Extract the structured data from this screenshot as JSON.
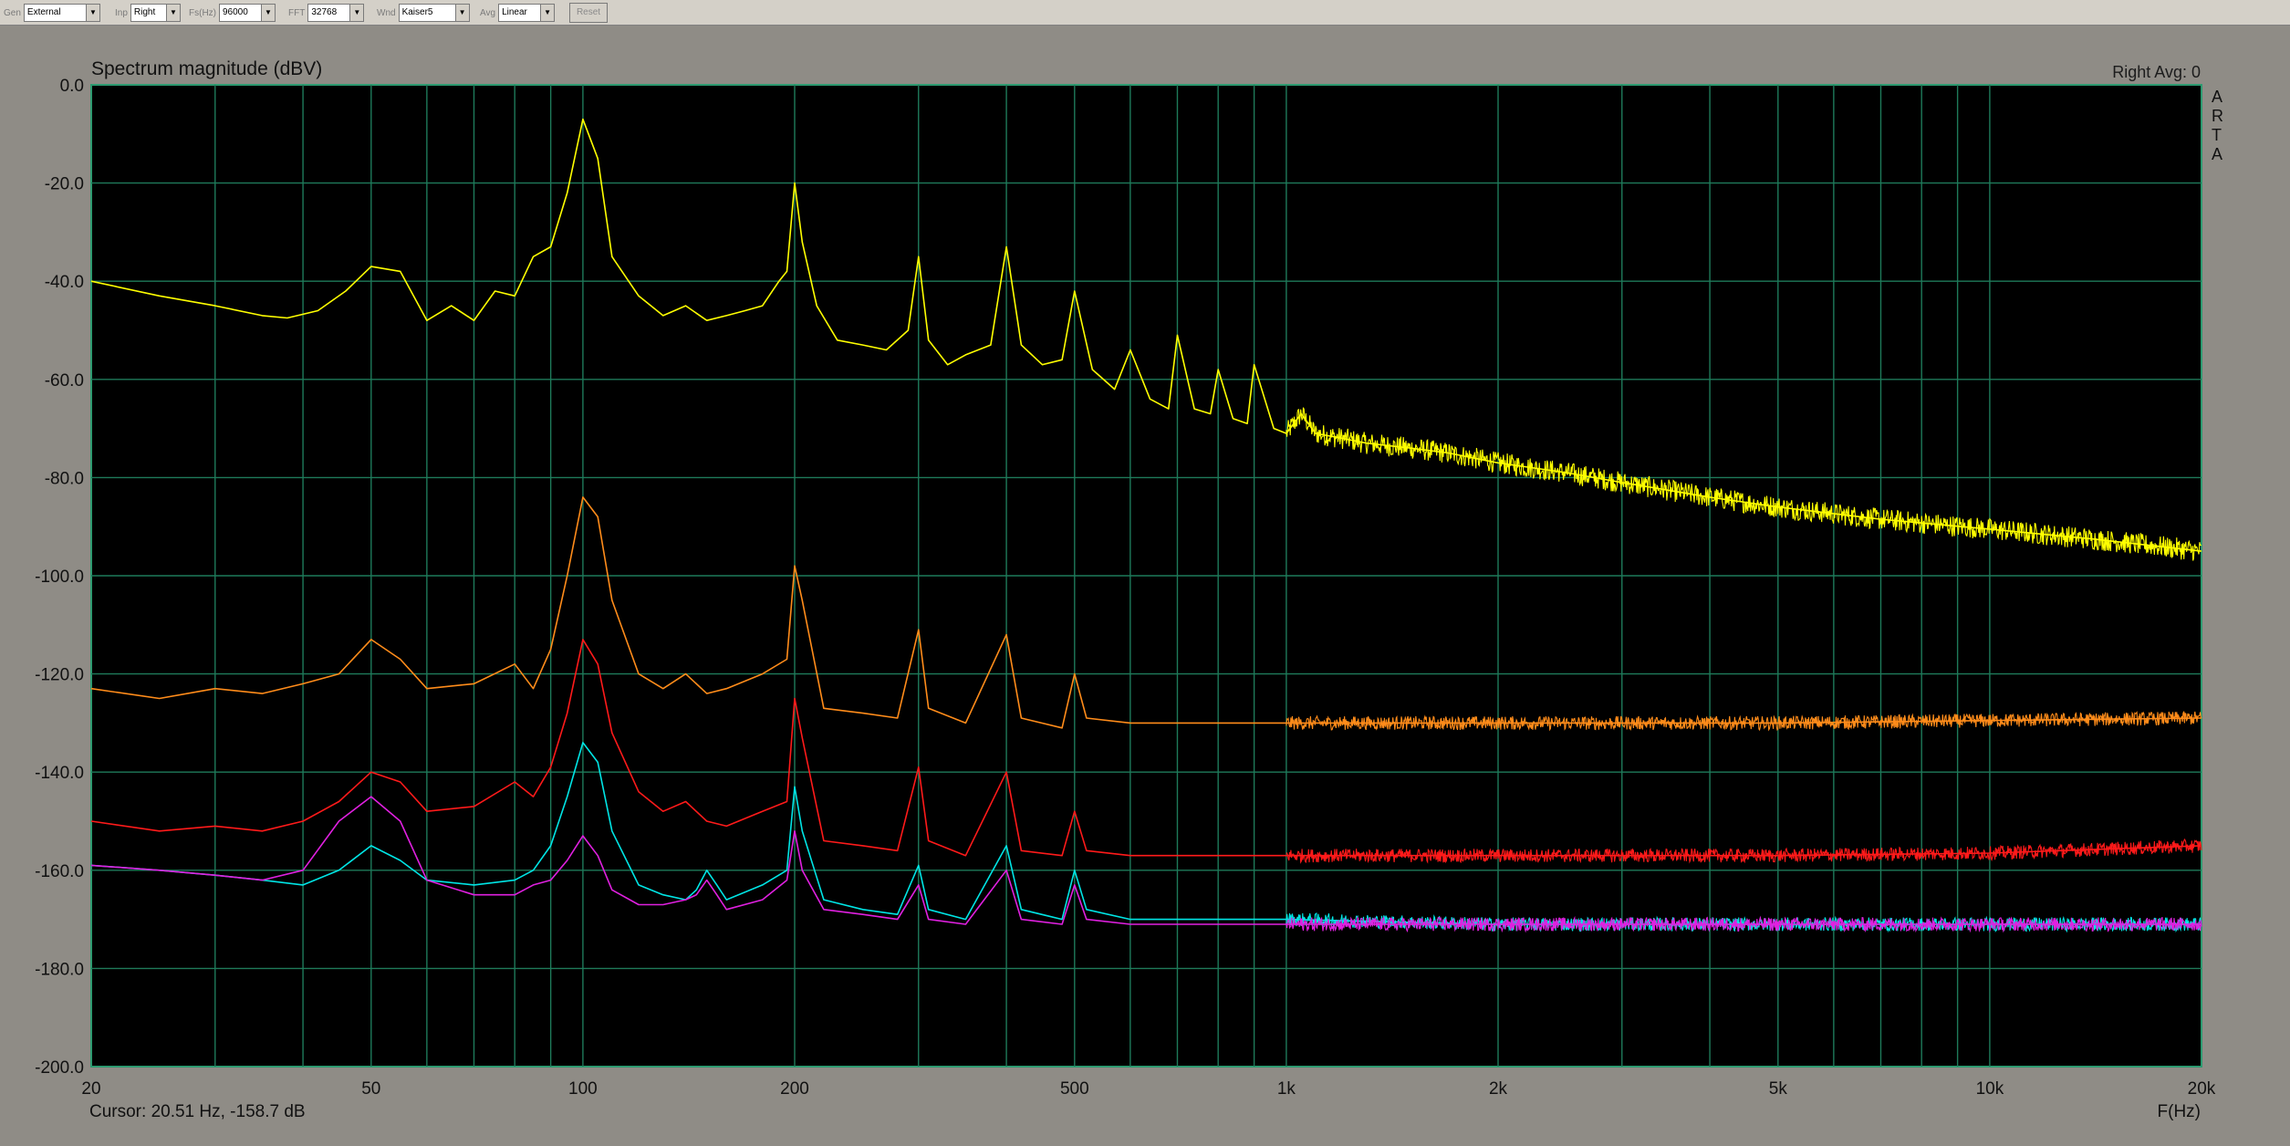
{
  "toolbar": {
    "gen_label": "Gen",
    "gen_value": "External",
    "inp_label": "Inp",
    "inp_value": "Right",
    "fs_label": "Fs(Hz)",
    "fs_value": "96000",
    "fft_label": "FFT",
    "fft_value": "32768",
    "wnd_label": "Wnd",
    "wnd_value": "Kaiser5",
    "avg_label": "Avg",
    "avg_value": "Linear",
    "reset_label": "Reset"
  },
  "overlay_status": "Right Avg: 0",
  "side_logo": [
    "A",
    "R",
    "T",
    "A"
  ],
  "cursor_text": "Cursor: 20.51 Hz, -158.7 dB",
  "colors": {
    "background": "#8f8c86",
    "plot_bg": "#000000",
    "grid": "#1e7a5a",
    "text": "#111111"
  },
  "chart_data": {
    "type": "line",
    "title": "Spectrum magnitude (dBV)",
    "xlabel": "F(Hz)",
    "ylabel": "",
    "x_scale": "log",
    "xlim": [
      20,
      20000
    ],
    "ylim": [
      -200,
      0
    ],
    "x_ticks": [
      {
        "v": 20,
        "label": "20"
      },
      {
        "v": 50,
        "label": "50"
      },
      {
        "v": 100,
        "label": "100"
      },
      {
        "v": 200,
        "label": "200"
      },
      {
        "v": 500,
        "label": "500"
      },
      {
        "v": 1000,
        "label": "1k"
      },
      {
        "v": 2000,
        "label": "2k"
      },
      {
        "v": 5000,
        "label": "5k"
      },
      {
        "v": 10000,
        "label": "10k"
      },
      {
        "v": 20000,
        "label": "20k"
      }
    ],
    "y_ticks": [
      {
        "v": 0,
        "label": "0.0"
      },
      {
        "v": -20,
        "label": "-20.0"
      },
      {
        "v": -40,
        "label": "-40.0"
      },
      {
        "v": -60,
        "label": "-60.0"
      },
      {
        "v": -80,
        "label": "-80.0"
      },
      {
        "v": -100,
        "label": "-100.0"
      },
      {
        "v": -120,
        "label": "-120.0"
      },
      {
        "v": -140,
        "label": "-140.0"
      },
      {
        "v": -160,
        "label": "-160.0"
      },
      {
        "v": -180,
        "label": "-180.0"
      },
      {
        "v": -200,
        "label": "-200.0"
      }
    ],
    "grid": true,
    "series": [
      {
        "color": "#ffff00",
        "x": [
          20,
          25,
          30,
          35,
          38,
          42,
          46,
          50,
          55,
          60,
          65,
          70,
          75,
          80,
          85,
          90,
          95,
          100,
          105,
          110,
          120,
          130,
          140,
          150,
          160,
          170,
          180,
          190,
          195,
          200,
          205,
          215,
          230,
          250,
          270,
          290,
          300,
          310,
          330,
          350,
          380,
          400,
          420,
          450,
          480,
          500,
          530,
          570,
          600,
          640,
          680,
          700,
          740,
          780,
          800,
          840,
          880,
          900,
          960,
          1000,
          1050,
          1100,
          1200,
          1300,
          1500,
          1700,
          2000,
          2500,
          3000,
          4000,
          5000,
          7000,
          10000,
          14000,
          20000
        ],
        "y": [
          -40,
          -43,
          -45,
          -47,
          -47.5,
          -46,
          -42,
          -37,
          -38,
          -48,
          -45,
          -48,
          -42,
          -43,
          -35,
          -33,
          -22,
          -7,
          -15,
          -35,
          -43,
          -47,
          -45,
          -48,
          -47,
          -46,
          -45,
          -40,
          -38,
          -20,
          -32,
          -45,
          -52,
          -53,
          -54,
          -50,
          -35,
          -52,
          -57,
          -55,
          -53,
          -33,
          -53,
          -57,
          -56,
          -42,
          -58,
          -62,
          -54,
          -64,
          -66,
          -51,
          -66,
          -67,
          -58,
          -68,
          -69,
          -57,
          -70,
          -71,
          -67,
          -71,
          -72,
          -73,
          -74,
          -75,
          -77,
          -79,
          -81,
          -84,
          -86,
          -88.5,
          -90.5,
          -92.5,
          -95
        ]
      },
      {
        "color": "#ff8c1a",
        "x": [
          20,
          25,
          30,
          35,
          40,
          45,
          50,
          55,
          60,
          70,
          80,
          85,
          90,
          95,
          100,
          105,
          110,
          120,
          130,
          140,
          150,
          160,
          180,
          195,
          200,
          205,
          220,
          250,
          280,
          300,
          310,
          350,
          400,
          420,
          480,
          500,
          520,
          600,
          700,
          1000,
          2000,
          5000,
          10000,
          20000
        ],
        "y": [
          -123,
          -125,
          -123,
          -124,
          -122,
          -120,
          -113,
          -117,
          -123,
          -122,
          -118,
          -123,
          -115,
          -100,
          -84,
          -88,
          -105,
          -120,
          -123,
          -120,
          -124,
          -123,
          -120,
          -117,
          -98,
          -105,
          -127,
          -128,
          -129,
          -111,
          -127,
          -130,
          -112,
          -129,
          -131,
          -120,
          -129,
          -130,
          -130,
          -130,
          -130,
          -130,
          -129.5,
          -129
        ]
      },
      {
        "color": "#ff1a1a",
        "x": [
          20,
          25,
          30,
          35,
          40,
          45,
          50,
          55,
          60,
          70,
          80,
          85,
          90,
          95,
          100,
          105,
          110,
          120,
          130,
          140,
          150,
          160,
          180,
          195,
          200,
          205,
          220,
          250,
          280,
          300,
          310,
          350,
          400,
          420,
          480,
          500,
          520,
          600,
          700,
          1000,
          2000,
          5000,
          10000,
          20000
        ],
        "y": [
          -150,
          -152,
          -151,
          -152,
          -150,
          -146,
          -140,
          -142,
          -148,
          -147,
          -142,
          -145,
          -139,
          -128,
          -113,
          -118,
          -132,
          -144,
          -148,
          -146,
          -150,
          -151,
          -148,
          -146,
          -125,
          -133,
          -154,
          -155,
          -156,
          -139,
          -154,
          -157,
          -140,
          -156,
          -157,
          -148,
          -156,
          -157,
          -157,
          -157,
          -157,
          -157,
          -156.5,
          -155
        ]
      },
      {
        "color": "#00e5e5",
        "x": [
          20,
          25,
          30,
          35,
          40,
          45,
          50,
          55,
          60,
          70,
          80,
          85,
          90,
          95,
          100,
          105,
          110,
          120,
          130,
          140,
          145,
          150,
          155,
          160,
          180,
          195,
          200,
          205,
          220,
          250,
          280,
          300,
          310,
          350,
          400,
          420,
          480,
          500,
          520,
          600,
          700,
          1000,
          2000,
          5000,
          10000,
          20000
        ],
        "y": [
          -159,
          -160,
          -161,
          -162,
          -163,
          -160,
          -155,
          -158,
          -162,
          -163,
          -162,
          -160,
          -155,
          -145,
          -134,
          -138,
          -152,
          -163,
          -165,
          -166,
          -164,
          -160,
          -163,
          -166,
          -163,
          -160,
          -143,
          -152,
          -166,
          -168,
          -169,
          -159,
          -168,
          -170,
          -155,
          -168,
          -170,
          -160,
          -168,
          -170,
          -170,
          -170,
          -171,
          -171,
          -171,
          -171
        ]
      },
      {
        "color": "#e020e0",
        "x": [
          20,
          25,
          30,
          35,
          40,
          45,
          50,
          55,
          60,
          70,
          80,
          85,
          90,
          95,
          100,
          105,
          110,
          120,
          130,
          140,
          145,
          150,
          155,
          160,
          180,
          195,
          200,
          205,
          220,
          250,
          280,
          300,
          310,
          350,
          400,
          420,
          480,
          500,
          520,
          600,
          700,
          1000,
          2000,
          5000,
          10000,
          20000
        ],
        "y": [
          -159,
          -160,
          -161,
          -162,
          -160,
          -150,
          -145,
          -150,
          -162,
          -165,
          -165,
          -163,
          -162,
          -158,
          -153,
          -157,
          -164,
          -167,
          -167,
          -166,
          -165,
          -162,
          -165,
          -168,
          -166,
          -162,
          -152,
          -160,
          -168,
          -169,
          -170,
          -163,
          -170,
          -171,
          -160,
          -170,
          -171,
          -163,
          -170,
          -171,
          -171,
          -171,
          -171,
          -171,
          -171,
          -171
        ]
      }
    ]
  }
}
